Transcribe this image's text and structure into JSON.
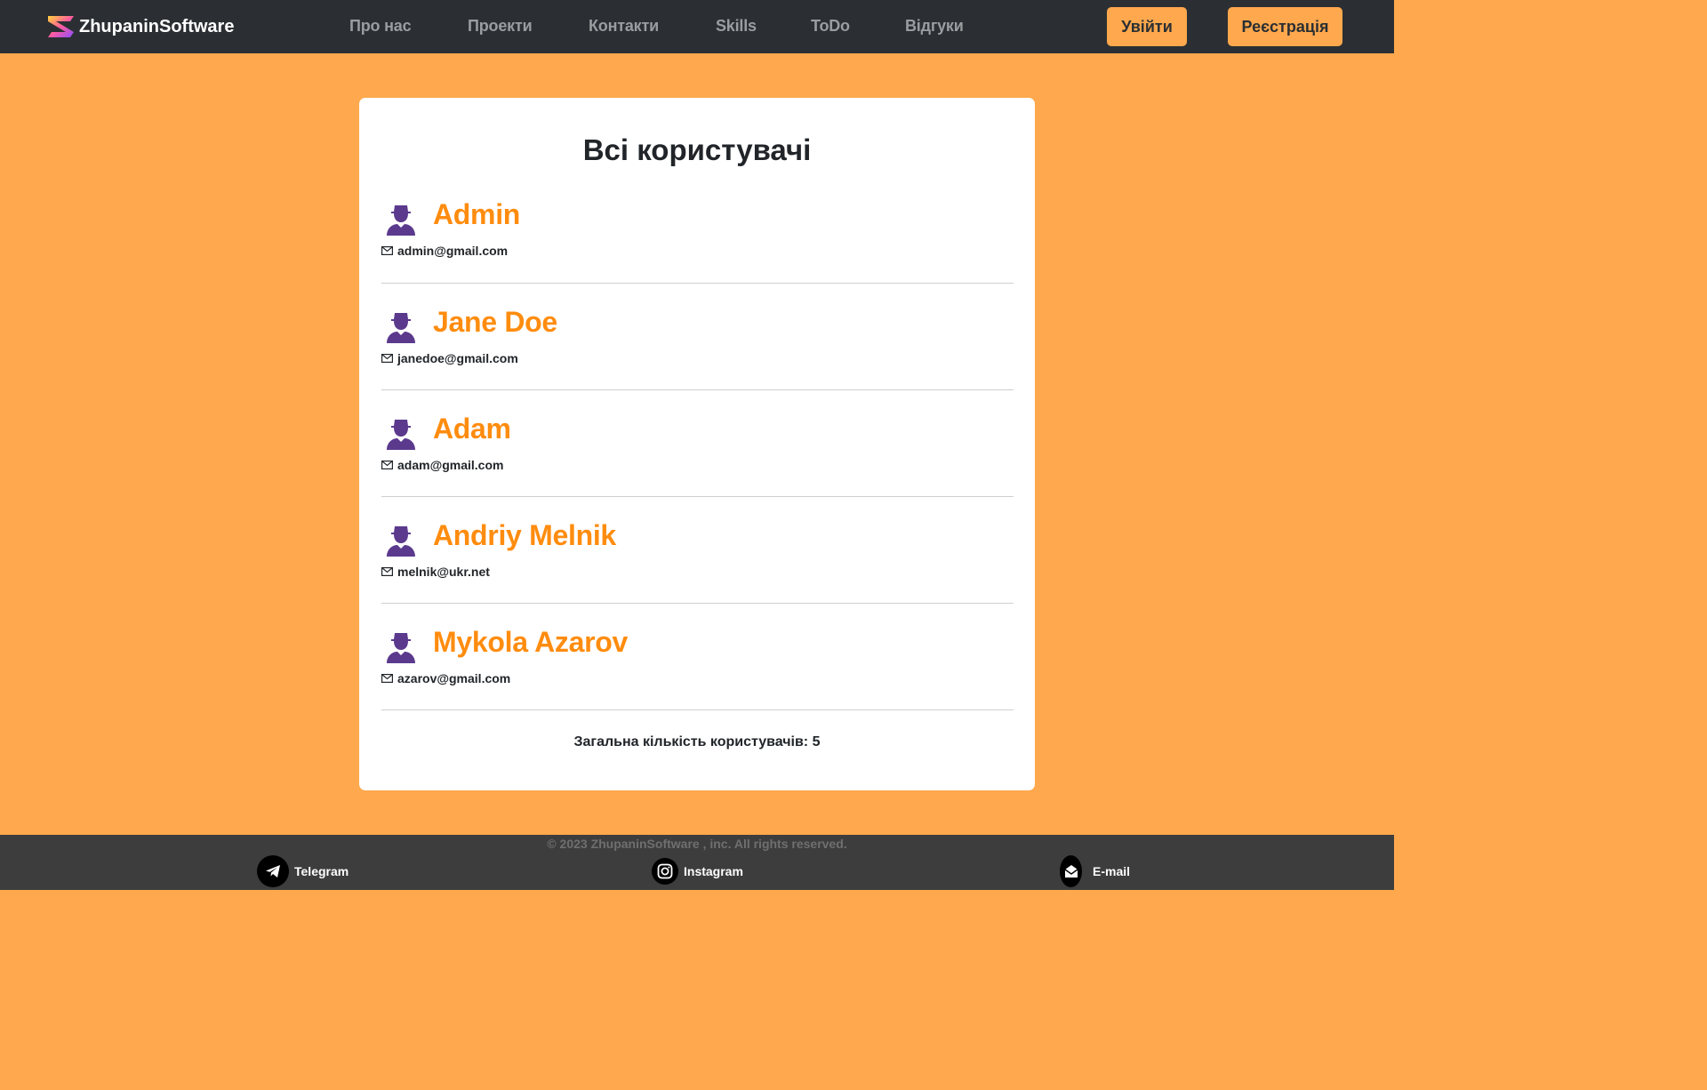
{
  "brand": {
    "name": "ZhupaninSoftware",
    "logo": "brand-logo-icon"
  },
  "nav": {
    "links": [
      "Про нас",
      "Проекти",
      "Контакти",
      "Skills",
      "ToDo",
      "Відгуки"
    ],
    "login_label": "Увійти",
    "register_label": "Реєстрація"
  },
  "page": {
    "title": "Всі користувачі",
    "users": [
      {
        "name": "Admin",
        "email": "admin@gmail.com",
        "avatar_icon": "user-icon",
        "email_icon": "envelope-icon"
      },
      {
        "name": "Jane Doe",
        "email": "janedoe@gmail.com",
        "avatar_icon": "user-icon",
        "email_icon": "envelope-icon"
      },
      {
        "name": "Adam",
        "email": "adam@gmail.com",
        "avatar_icon": "user-icon",
        "email_icon": "envelope-icon"
      },
      {
        "name": "Andriy Melnik",
        "email": "melnik@ukr.net",
        "avatar_icon": "user-icon",
        "email_icon": "envelope-icon"
      },
      {
        "name": "Mykola Azarov",
        "email": "azarov@gmail.com",
        "avatar_icon": "user-icon",
        "email_icon": "envelope-icon"
      }
    ],
    "total_label": "Загальна кількість користувачів:",
    "total_count": "5"
  },
  "footer": {
    "copyright": "© 2023 ZhupaninSoftware , inc. All rights reserved.",
    "socials": [
      {
        "label": "Telegram",
        "icon": "telegram-icon"
      },
      {
        "label": "Instagram",
        "icon": "instagram-icon"
      },
      {
        "label": "E-mail",
        "icon": "email-icon"
      }
    ]
  },
  "colors": {
    "page_background": "#ffa84d",
    "navbar": "#2b2f33",
    "accent_name": "#ff8c0f",
    "avatar": "#5b3a8e",
    "footer": "#3d3d3d"
  }
}
